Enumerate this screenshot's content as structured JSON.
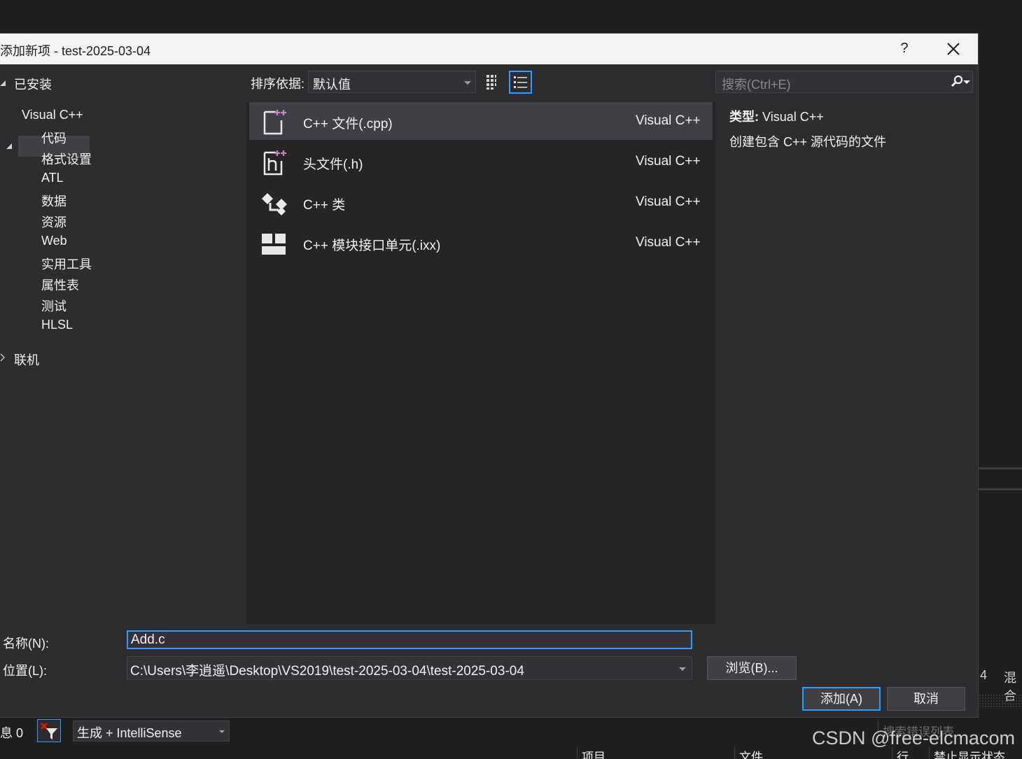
{
  "dialog": {
    "title": "添加新项 - test-2025-03-04",
    "help": "?"
  },
  "tree": {
    "installed": "已安装",
    "visual_cpp": "Visual C++",
    "children": [
      "代码",
      "格式设置",
      "ATL",
      "数据",
      "资源",
      "Web",
      "实用工具",
      "属性表",
      "测试",
      "HLSL"
    ],
    "online": "联机"
  },
  "toolbar": {
    "sort_label": "排序依据:",
    "sort_value": "默认值",
    "search_placeholder": "搜索(Ctrl+E)"
  },
  "items": [
    {
      "name": "C++ 文件(.cpp)",
      "lang": "Visual C++",
      "icon": "cpp-file-icon",
      "selected": true
    },
    {
      "name": "头文件(.h)",
      "lang": "Visual C++",
      "icon": "header-file-icon",
      "selected": false
    },
    {
      "name": "C++ 类",
      "lang": "Visual C++",
      "icon": "cpp-class-icon",
      "selected": false
    },
    {
      "name": "C++ 模块接口单元(.ixx)",
      "lang": "Visual C++",
      "icon": "module-unit-icon",
      "selected": false
    }
  ],
  "info": {
    "type_label": "类型:",
    "type_value": "Visual C++",
    "description": "创建包含 C++ 源代码的文件"
  },
  "form": {
    "name_label": "名称(N):",
    "name_value": "Add.c",
    "location_label": "位置(L):",
    "location_value": "C:\\Users\\李逍遥\\Desktop\\VS2019\\test-2025-03-04\\test-2025-03-04",
    "browse": "浏览(B)...",
    "add": "添加(A)",
    "cancel": "取消"
  },
  "background": {
    "messages": "息 0",
    "build_filter": "生成 + IntelliSense",
    "search_errors": "搜索错误列表",
    "right_num": "4",
    "right_text": "混合",
    "col_project": "项目",
    "col_file": "文件",
    "col_line": "行",
    "col_suppress": "禁止显示状态",
    "watermark": "CSDN @free-elcmacom"
  },
  "colors": {
    "accent": "#3399ff",
    "dialog_bg": "#2d2d30",
    "list_bg": "#252526",
    "selected_bg": "#3f3f46",
    "titlebar_bg": "#f3f3f3",
    "plus_color": "#c586c0"
  }
}
